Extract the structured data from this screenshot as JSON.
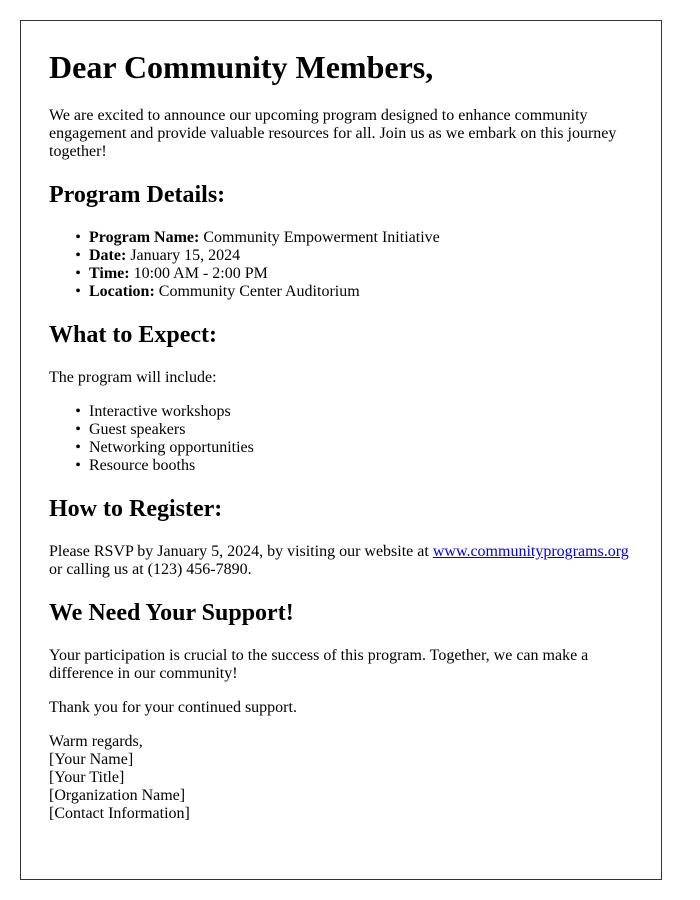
{
  "letter": {
    "greeting": "Dear Community Members,",
    "intro": "We are excited to announce our upcoming program designed to enhance community engagement and provide valuable resources for all. Join us as we embark on this journey together!",
    "details": {
      "heading": "Program Details:",
      "items": [
        {
          "label": "Program Name:",
          "value": " Community Empowerment Initiative"
        },
        {
          "label": "Date:",
          "value": " January 15, 2024"
        },
        {
          "label": "Time:",
          "value": " 10:00 AM - 2:00 PM"
        },
        {
          "label": "Location:",
          "value": " Community Center Auditorium"
        }
      ]
    },
    "expect": {
      "heading": "What to Expect:",
      "intro": "The program will include:",
      "items": [
        "Interactive workshops",
        "Guest speakers",
        "Networking opportunities",
        "Resource booths"
      ]
    },
    "register": {
      "heading": "How to Register:",
      "text_before": "Please RSVP by January 5, 2024, by visiting our website at ",
      "link_text": "www.communityprograms.org",
      "text_after": " or calling us at (123) 456-7890."
    },
    "support": {
      "heading": "We Need Your Support!",
      "text": "Your participation is crucial to the success of this program. Together, we can make a difference in our community!"
    },
    "thanks": "Thank you for your continued support.",
    "signature": {
      "closing": "Warm regards,",
      "name": "[Your Name]",
      "title": "[Your Title]",
      "organization": "[Organization Name]",
      "contact": "[Contact Information]"
    },
    "bullet_glyph": "•"
  },
  "colors": {
    "text": "#000000",
    "link": "#0000ee",
    "border": "#333333",
    "background": "#ffffff"
  }
}
